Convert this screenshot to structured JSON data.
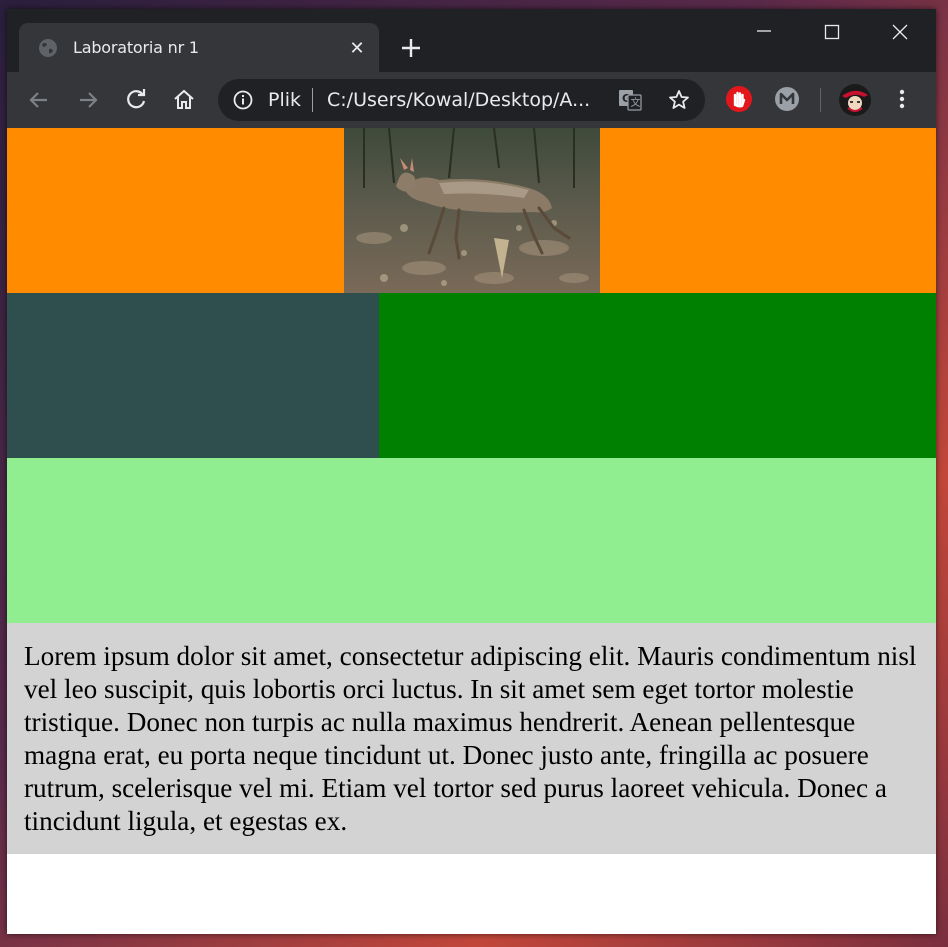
{
  "tab": {
    "title": "Laboratoria nr 1",
    "favicon": "globe-icon"
  },
  "omnibox": {
    "scheme_label": "Plik",
    "url": "C:/Users/Kowal/Desktop/A..."
  },
  "extensions": [
    "adblock-hand-icon",
    "mega-m-icon",
    "profile-avatar"
  ],
  "page": {
    "colors": {
      "row1": "#ff8c00",
      "row2_left": "#2f4f4f",
      "row2_right": "#008000",
      "row3": "#90ee90",
      "text_background": "#d3d3d3"
    },
    "image": {
      "description_icon": "deer-photo"
    },
    "paragraph": "Lorem ipsum dolor sit amet, consectetur adipiscing elit. Mauris condimentum nisl vel leo suscipit, quis lobortis orci luctus. In sit amet sem eget tortor molestie tristique. Donec non turpis ac nulla maximus hendrerit. Aenean pellentesque magna erat, eu porta neque tincidunt ut. Donec justo ante, fringilla ac posuere rutrum, scelerisque vel mi. Etiam vel tortor sed purus laoreet vehicula. Donec a tincidunt ligula, et egestas ex."
  }
}
